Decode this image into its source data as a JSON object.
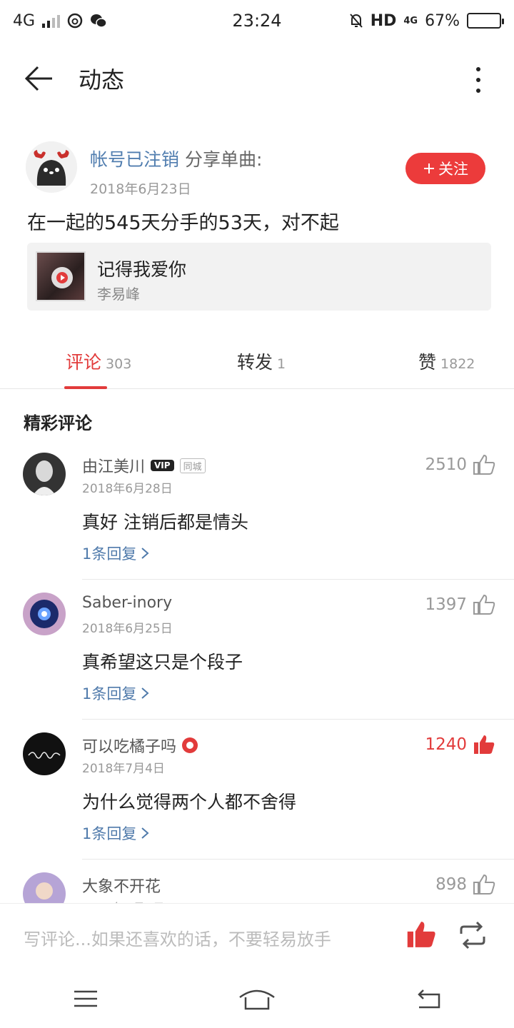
{
  "status_bar": {
    "network": "4G",
    "time": "23:24",
    "hd": "HD",
    "net_right": "4G",
    "battery": "67%",
    "battery_level": 0.67
  },
  "header": {
    "title": "动态"
  },
  "post": {
    "username": "帐号已注销",
    "action": " 分享单曲:",
    "date": "2018年6月23日",
    "follow_label": "关注",
    "text": "在一起的545天分手的53天，对不起",
    "song": {
      "title": "记得我爱你",
      "artist": "李易峰"
    }
  },
  "tabs": [
    {
      "label": "评论",
      "count": "303"
    },
    {
      "label": "转发",
      "count": "1"
    },
    {
      "label": "赞",
      "count": "1822"
    }
  ],
  "section": {
    "title": "精彩评论"
  },
  "comments": [
    {
      "name": "由江美川",
      "vip": "VIP",
      "loc": "同城",
      "date": "2018年6月28日",
      "text": "真好 注销后都是情头",
      "reply": "1条回复",
      "likes": "2510"
    },
    {
      "name": "Saber-inory",
      "date": "2018年6月25日",
      "text": "真希望这只是个段子",
      "reply": "1条回复",
      "likes": "1397"
    },
    {
      "name": "可以吃橘子吗",
      "date": "2018年7月4日",
      "text": "为什么觉得两个人都不舍得",
      "reply": "1条回复",
      "likes": "1240"
    },
    {
      "name": "大象不开花",
      "date": "2018年7月1日",
      "likes": "898"
    }
  ],
  "bottom_bar": {
    "placeholder": "写评论...如果还喜欢的话，不要轻易放手"
  },
  "colors": {
    "accent": "#e23b3b",
    "link": "#4f7aab"
  }
}
